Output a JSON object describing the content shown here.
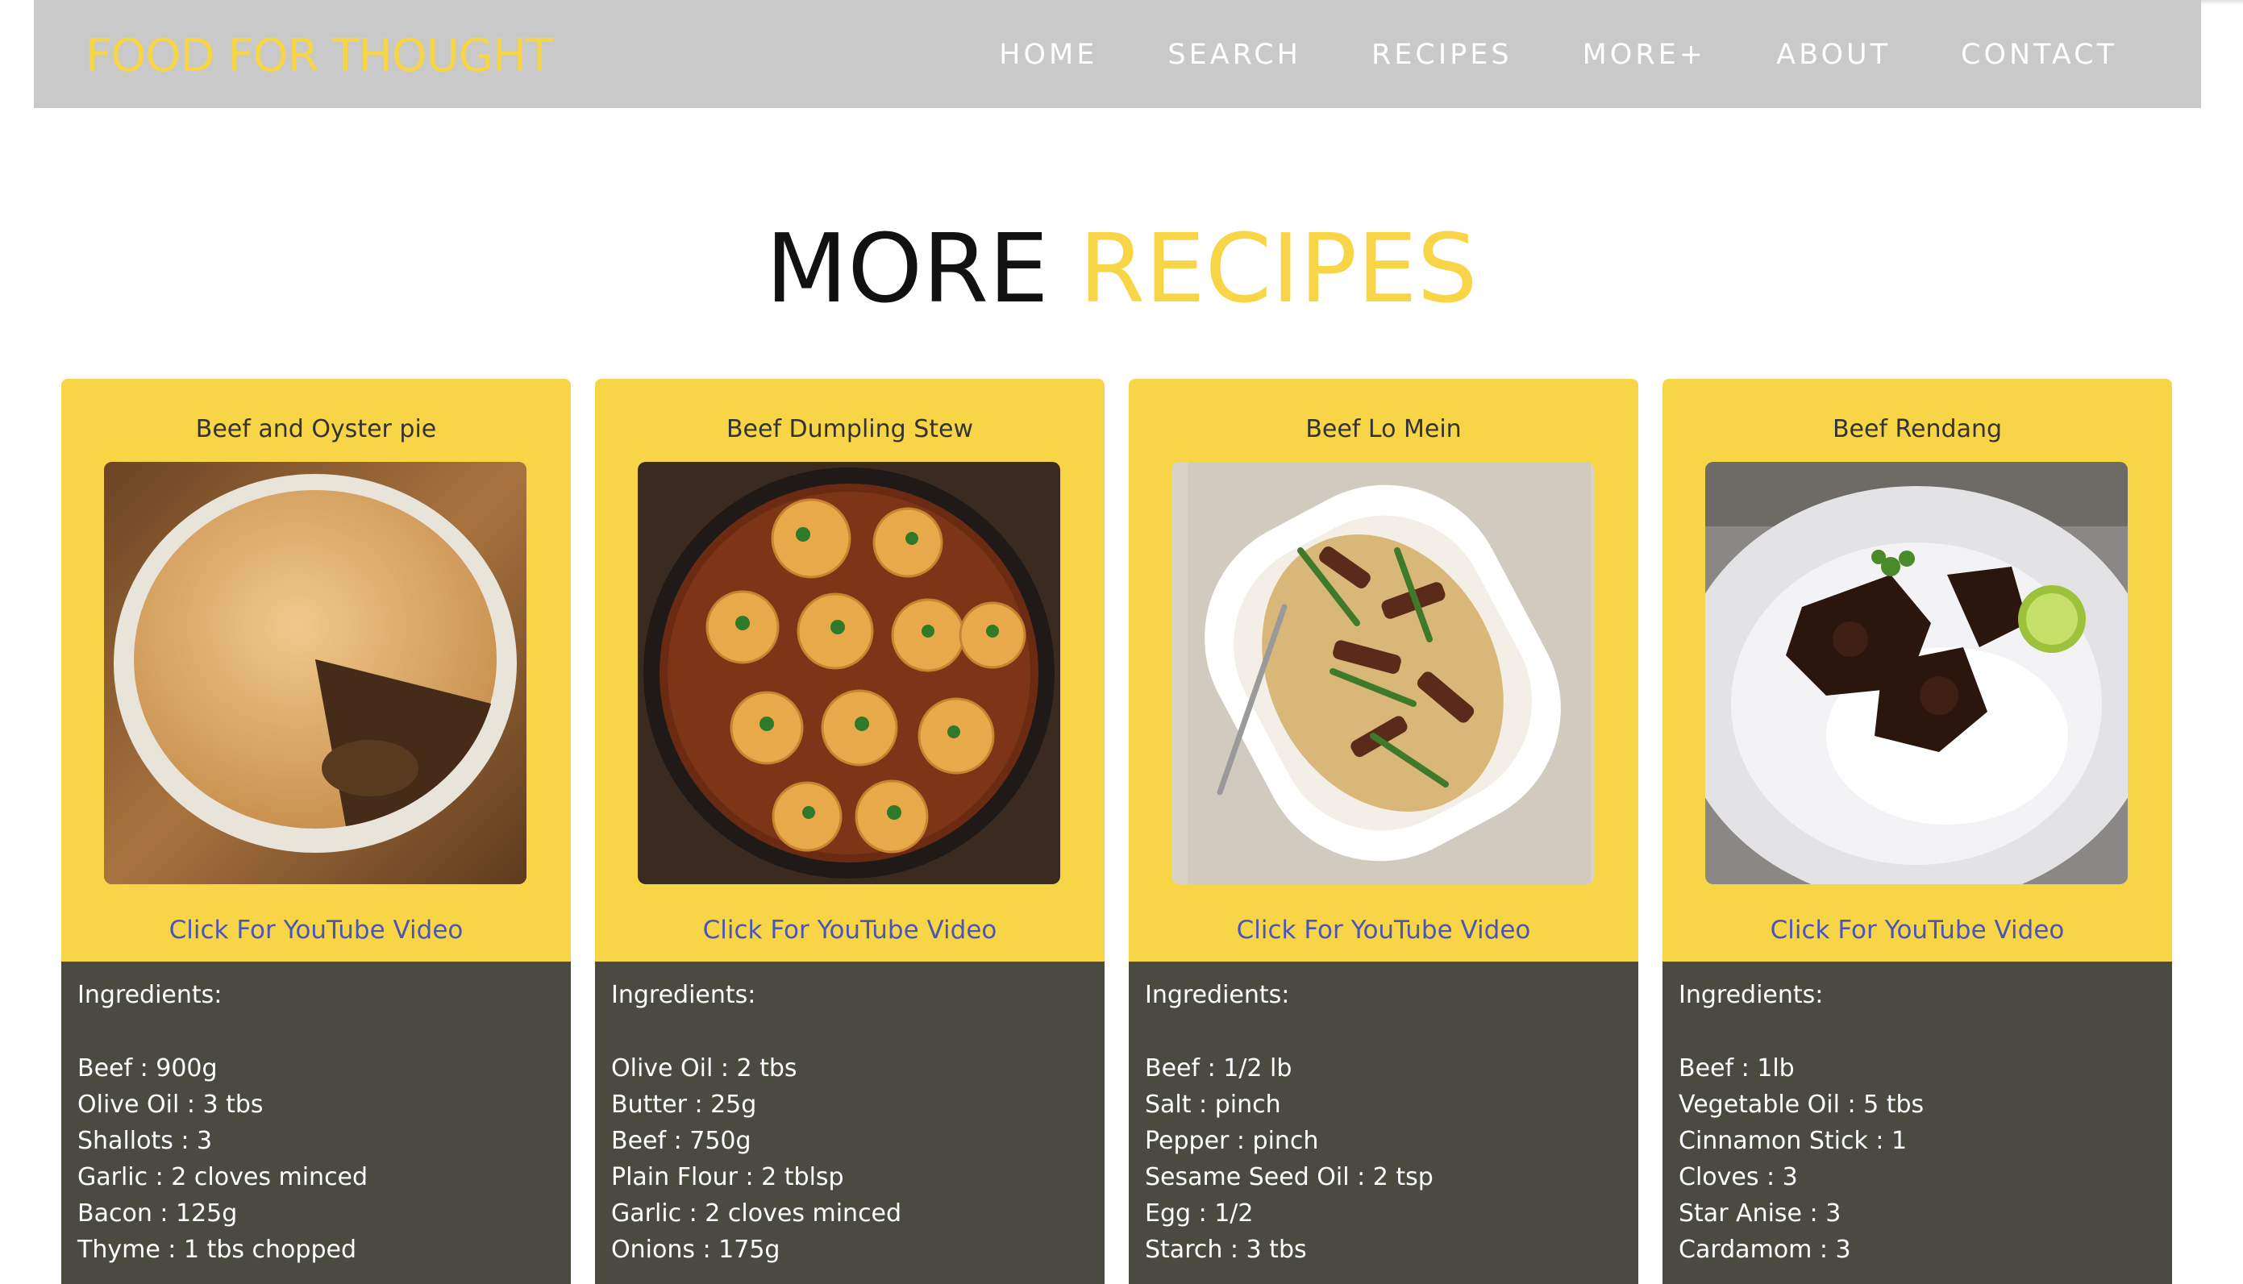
{
  "nav": {
    "brand": "FOOD FOR THOUGHT",
    "links": [
      "HOME",
      "SEARCH",
      "RECIPES",
      "MORE+",
      "ABOUT",
      "CONTACT"
    ]
  },
  "page": {
    "title_main": "MORE",
    "title_accent": "RECIPES"
  },
  "colors": {
    "accent_yellow": "#f7d547",
    "nav_bg": "#c9c9c9",
    "card_bottom_bg": "#4a4a41",
    "link_blue": "#4a56b6"
  },
  "cards": [
    {
      "title": "Beef and Oyster pie",
      "image_name": "beef-oyster-pie-photo",
      "link_text": "Click For YouTube Video",
      "ingredients_label": "Ingredients:",
      "ingredients": [
        "Beef : 900g",
        "Olive Oil : 3 tbs",
        "Shallots : 3",
        "Garlic : 2 cloves minced",
        "Bacon : 125g",
        "Thyme : 1 tbs chopped"
      ]
    },
    {
      "title": "Beef Dumpling Stew",
      "image_name": "beef-dumpling-stew-photo",
      "link_text": "Click For YouTube Video",
      "ingredients_label": "Ingredients:",
      "ingredients": [
        "Olive Oil : 2 tbs",
        "Butter : 25g",
        "Beef : 750g",
        "Plain Flour : 2 tblsp",
        "Garlic : 2 cloves minced",
        "Onions : 175g"
      ]
    },
    {
      "title": "Beef Lo Mein",
      "image_name": "beef-lo-mein-photo",
      "link_text": "Click For YouTube Video",
      "ingredients_label": "Ingredients:",
      "ingredients": [
        "Beef : 1/2 lb",
        "Salt : pinch",
        "Pepper : pinch",
        "Sesame Seed Oil : 2 tsp",
        "Egg : 1/2",
        "Starch : 3 tbs"
      ]
    },
    {
      "title": "Beef Rendang",
      "image_name": "beef-rendang-photo",
      "link_text": "Click For YouTube Video",
      "ingredients_label": "Ingredients:",
      "ingredients": [
        "Beef : 1lb",
        "Vegetable Oil : 5 tbs",
        "Cinnamon Stick : 1",
        "Cloves : 3",
        "Star Anise : 3",
        "Cardamom : 3"
      ]
    }
  ]
}
